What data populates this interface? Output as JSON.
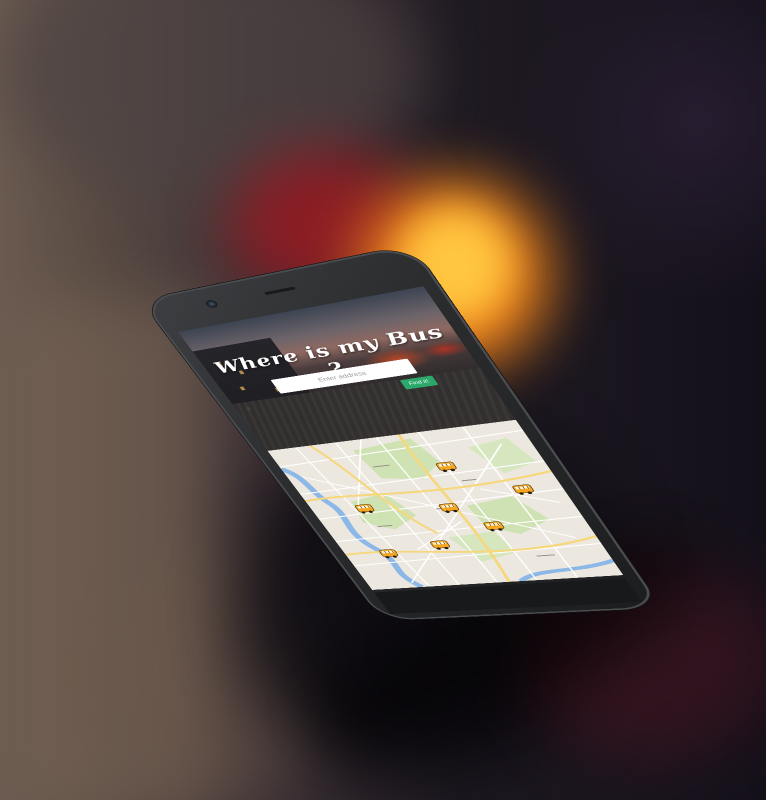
{
  "hero": {
    "title": "Where is my Bus ?"
  },
  "search": {
    "placeholder": "Enter address",
    "button_label": "Find it!"
  },
  "map": {
    "bus_markers": 7,
    "colors": {
      "land": "#ece8df",
      "park": "#cfe2b4",
      "water": "#8cb8e8",
      "road_major": "#f6d77c",
      "road_minor": "#ffffff"
    }
  },
  "colors": {
    "button": "#2ca86a",
    "bus_icon": "#f5a623",
    "phone_body": "#2a2c2e"
  }
}
